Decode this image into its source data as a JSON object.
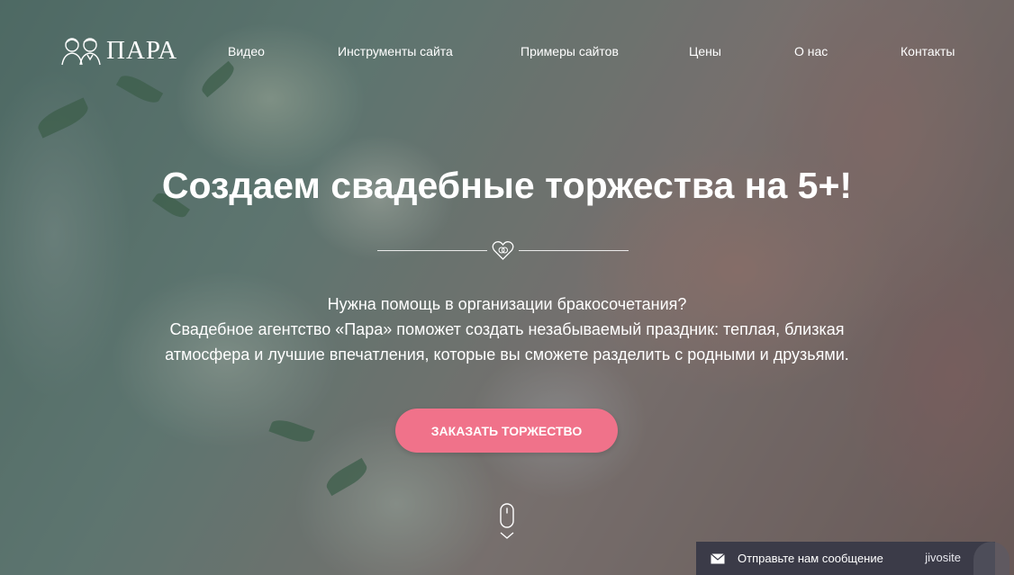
{
  "brand": {
    "name": "ПАРА"
  },
  "nav": {
    "items": [
      {
        "label": "Видео"
      },
      {
        "label": "Инструменты сайта"
      },
      {
        "label": "Примеры сайтов"
      },
      {
        "label": "Цены"
      },
      {
        "label": "О нас"
      },
      {
        "label": "Контакты"
      }
    ]
  },
  "hero": {
    "title": "Создаем свадебные торжества на 5+!",
    "text_lines": [
      "Нужна помощь в организации бракосочетания?",
      "Свадебное агентство «Пара» поможет создать незабываемый праздник: теплая, близкая",
      "атмосфера и лучшие впечатления, которые вы сможете разделить с родными и друзьями."
    ],
    "cta_label": "ЗАКАЗАТЬ ТОРЖЕСТВО"
  },
  "chat": {
    "text": "Отправьте нам сообщение",
    "brand": "jivosite"
  },
  "colors": {
    "accent": "#f0728a",
    "chat_bg": "#3b3b48",
    "text": "#ffffff"
  },
  "icons": {
    "logo": "couple-icon",
    "divider": "heart-rings-icon",
    "scroll": "mouse-scroll-icon",
    "chat": "envelope-icon"
  }
}
